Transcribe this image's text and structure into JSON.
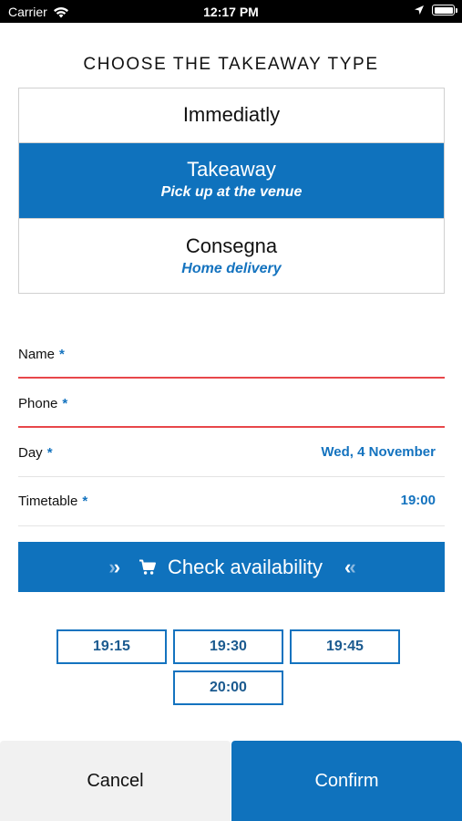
{
  "status_bar": {
    "carrier": "Carrier",
    "time": "12:17 PM"
  },
  "title": "CHOOSE THE TAKEAWAY TYPE",
  "takeaway_options": [
    {
      "title": "Immediatly",
      "subtitle": "",
      "selected": false
    },
    {
      "title": "Takeaway",
      "subtitle": "Pick up at the venue",
      "selected": true
    },
    {
      "title": "Consegna",
      "subtitle": "Home delivery",
      "selected": false
    }
  ],
  "form": {
    "required_marker": "*",
    "name": {
      "label": "Name",
      "value": ""
    },
    "phone": {
      "label": "Phone",
      "value": ""
    },
    "day": {
      "label": "Day",
      "value": "Wed, 4 November"
    },
    "timetable": {
      "label": "Timetable",
      "value": "19:00"
    }
  },
  "check_availability": {
    "label": "Check availability",
    "left_chevrons": "››",
    "right_chevrons": "‹‹",
    "icon": "cart-icon"
  },
  "time_slots": [
    "19:15",
    "19:30",
    "19:45",
    "20:00"
  ],
  "footer": {
    "cancel_label": "Cancel",
    "confirm_label": "Confirm"
  },
  "colors": {
    "accent": "#0f72bd",
    "accent_text": "#1473bf",
    "error": "#e8474a",
    "cancel_bg": "#f1f1f1"
  }
}
